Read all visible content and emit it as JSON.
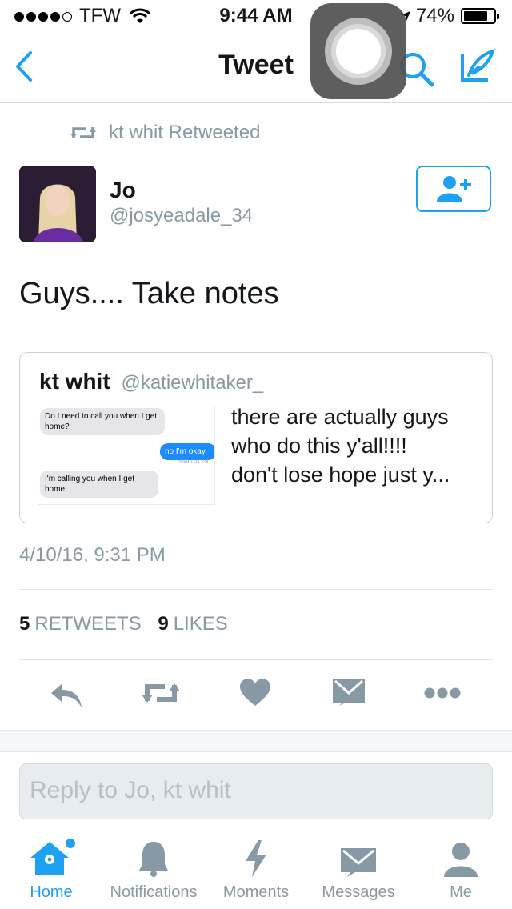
{
  "status": {
    "carrier": "TFW",
    "time": "9:44 AM",
    "battery": "74%"
  },
  "nav": {
    "title": "Tweet"
  },
  "retweet_context": "kt whit Retweeted",
  "tweet": {
    "name": "Jo",
    "handle": "@josyeadale_34",
    "text": "Guys.... Take notes",
    "timestamp": "4/10/16, 9:31 PM",
    "retweets_count": "5",
    "retweets_label": "RETWEETS",
    "likes_count": "9",
    "likes_label": "LIKES"
  },
  "quoted": {
    "name": "kt whit",
    "handle": "@katiewhitaker_",
    "text": "there are actually guys\nwho do this y'all!!!!\ndon't lose hope just y...",
    "thumbnail": {
      "msg1": "Do I need to call you when I get home?",
      "msg2": "no I'm okay",
      "read": "Read 7:31 PM",
      "msg3": "I'm calling you when I get home"
    }
  },
  "reply": {
    "placeholder": "Reply to Jo, kt whit"
  },
  "tabs": {
    "home": "Home",
    "notifications": "Notifications",
    "moments": "Moments",
    "messages": "Messages",
    "me": "Me"
  },
  "colors": {
    "accent": "#1da1f2",
    "icon_gray": "#8899a6"
  }
}
